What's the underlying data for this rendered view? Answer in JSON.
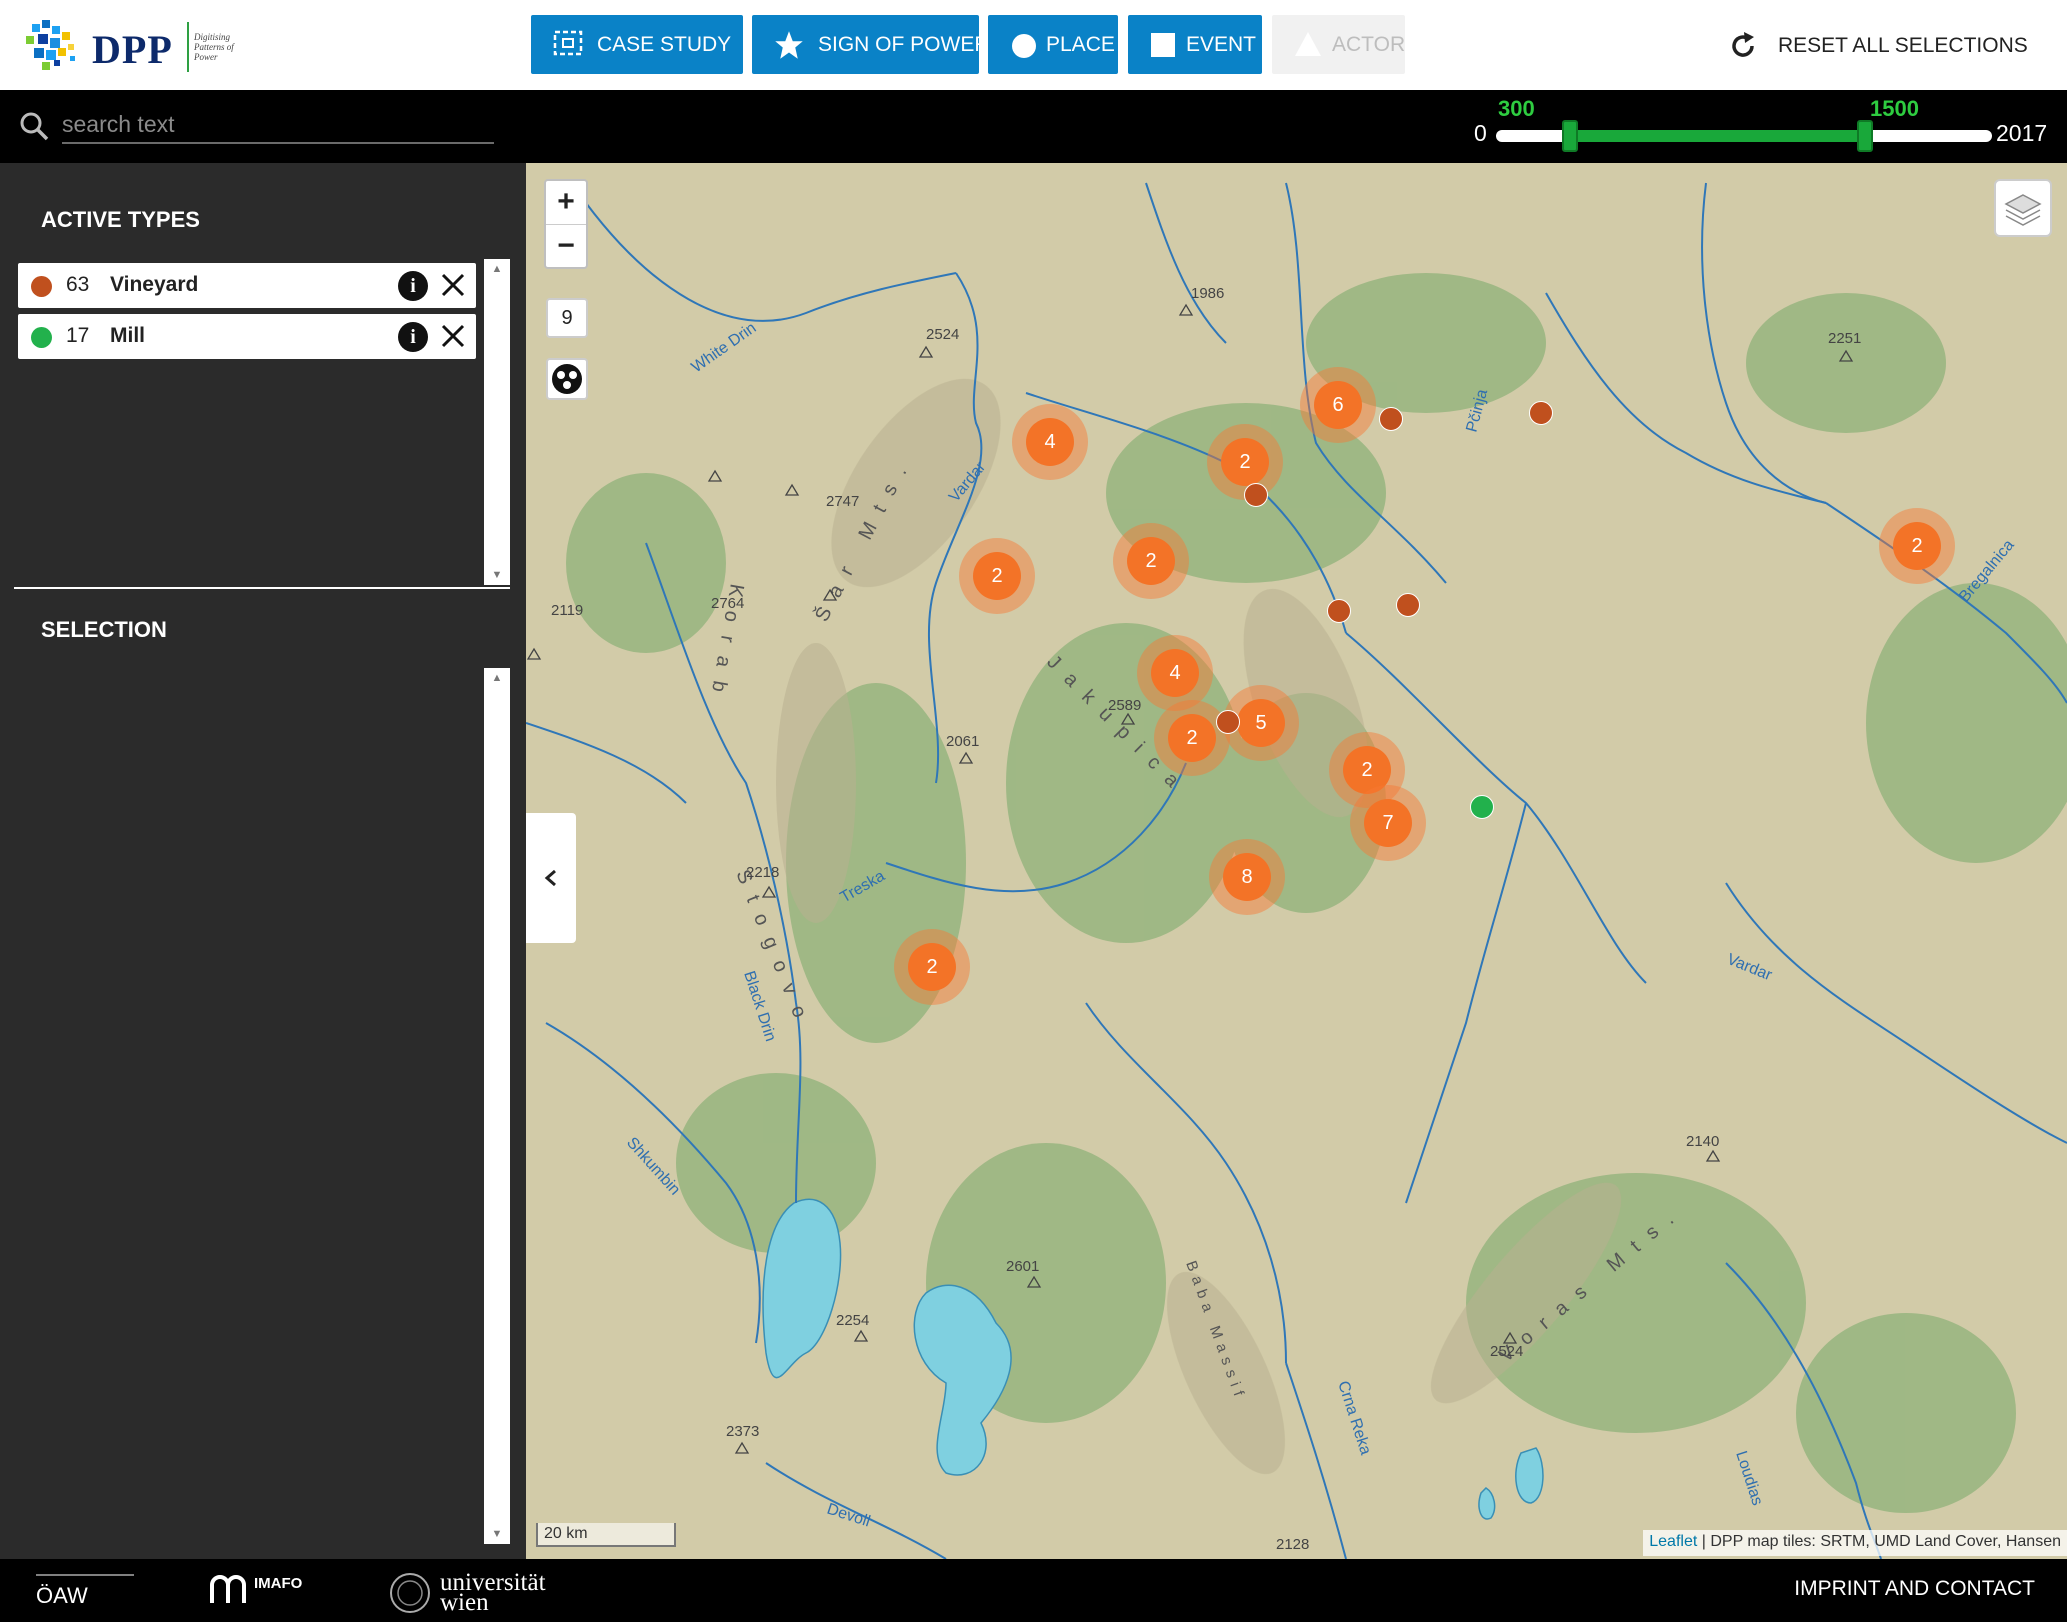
{
  "brand": {
    "name": "DPP",
    "tagline": "Digitising Patterns of Power"
  },
  "nav": {
    "buttons": [
      {
        "label": "CASE STUDY",
        "icon": "case-study-icon",
        "enabled": true
      },
      {
        "label": "SIGN OF POWER",
        "icon": "star-icon",
        "enabled": true
      },
      {
        "label": "PLACE",
        "icon": "circle-icon",
        "enabled": true
      },
      {
        "label": "EVENT",
        "icon": "square-icon",
        "enabled": true
      },
      {
        "label": "ACTOR",
        "icon": "triangle-icon",
        "enabled": false
      }
    ],
    "reset_label": "RESET ALL SELECTIONS"
  },
  "search": {
    "placeholder": "search text",
    "value": ""
  },
  "timeline": {
    "min": "0",
    "max": "2017",
    "from": "300",
    "to": "1500"
  },
  "sidebar": {
    "active_types_title": "ACTIVE TYPES",
    "selection_title": "SELECTION",
    "types": [
      {
        "count": "63",
        "name": "Vineyard",
        "color": "#c0501e"
      },
      {
        "count": "17",
        "name": "Mill",
        "color": "#22b14c"
      }
    ]
  },
  "map": {
    "zoom_level": "9",
    "scale_label": "20 km",
    "attribution_link": "Leaflet",
    "attribution_text": " | DPP map tiles: SRTM, UMD Land Cover, Hansen",
    "cluster_color": "#f37327",
    "clusters": [
      {
        "count": "4"
      },
      {
        "count": "6"
      },
      {
        "count": "2"
      },
      {
        "count": "2"
      },
      {
        "count": "2"
      },
      {
        "count": "4"
      },
      {
        "count": "2"
      },
      {
        "count": "5"
      },
      {
        "count": "2"
      },
      {
        "count": "7"
      },
      {
        "count": "8"
      },
      {
        "count": "2"
      },
      {
        "count": "2"
      }
    ],
    "labels": {
      "white_drin": "White Drin",
      "vardar_1": "Vardar",
      "vardar_2": "Vardar",
      "pcinja": "Pčinja",
      "bregalnica": "Bregalnica",
      "treska": "Treska",
      "black_drin": "Black Drin",
      "shkumbin": "Shkumbin",
      "crna_reka": "Crna Reka",
      "devoll": "Devoll",
      "loudias": "Loudias",
      "sar_mts": "Šar Mts.",
      "korab": "Korab",
      "jakupica": "Jakupica",
      "stogovo": "Stogovo",
      "voras_mts": "Voras Mts.",
      "baba_massif": "Baba Massif"
    },
    "peaks": [
      "1986",
      "2524",
      "2747",
      "2764",
      "2119",
      "2061",
      "2589",
      "2218",
      "2601",
      "2254",
      "2373",
      "2128",
      "2251",
      "2140",
      "2524"
    ]
  },
  "footer": {
    "link_label": "IMPRINT AND CONTACT",
    "logos": [
      "ÖAW",
      "IMAFO",
      "universität wien"
    ]
  }
}
